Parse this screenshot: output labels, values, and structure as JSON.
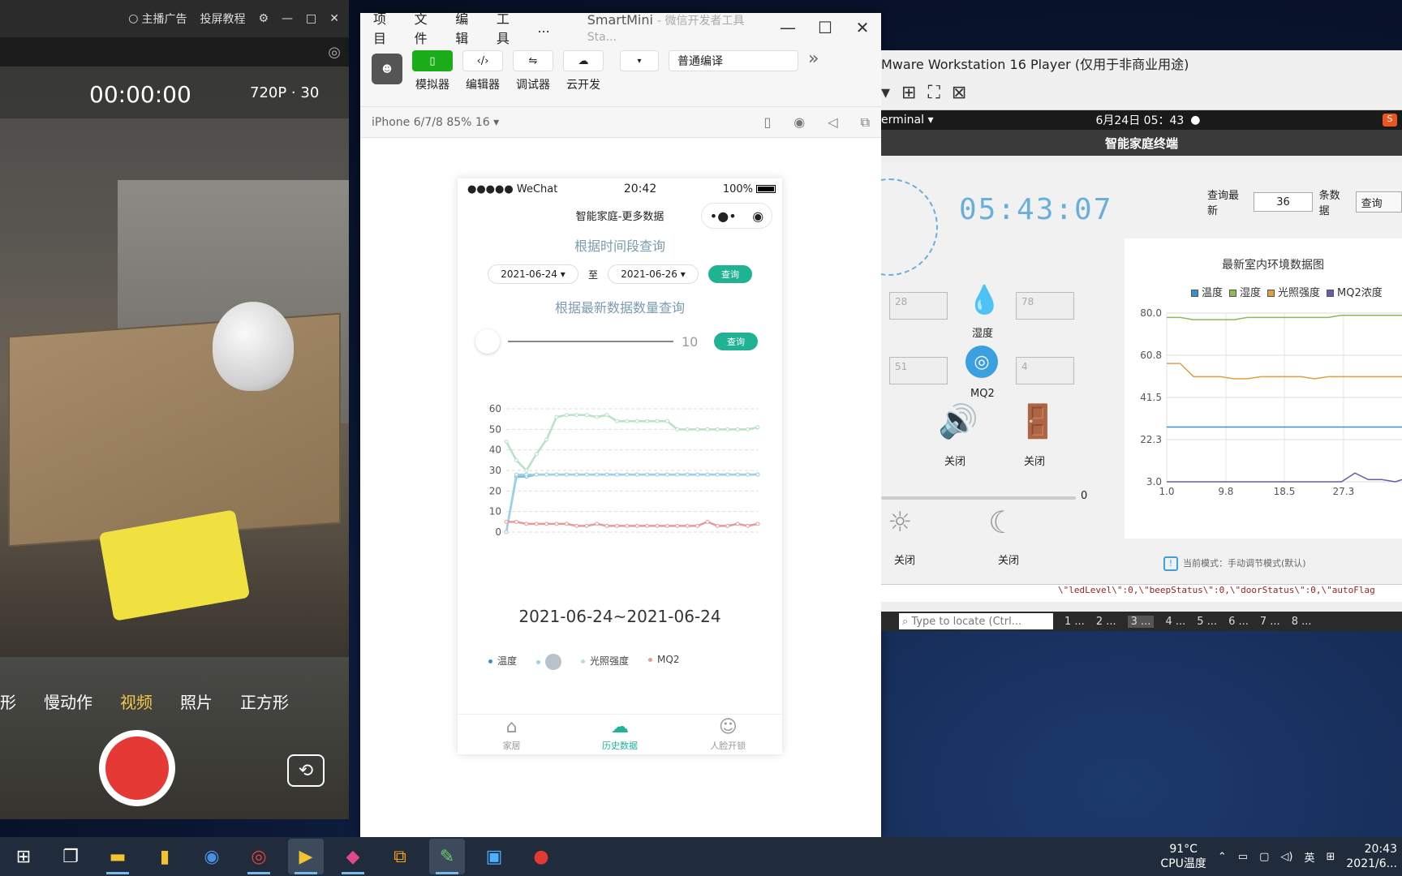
{
  "camera": {
    "title_ad": "主播广告",
    "title_tutorial": "投屏教程",
    "timer": "00:00:00",
    "resolution": "720P · 30",
    "modes": [
      "形",
      "慢动作",
      "视频",
      "照片",
      "正方形"
    ],
    "active_mode": "视频"
  },
  "devtools": {
    "menus": [
      "项目",
      "文件",
      "编辑",
      "工具",
      "..."
    ],
    "title": "SmartMini",
    "subtitle": "- 微信开发者工具 Sta...",
    "tools": [
      {
        "label": "模拟器",
        "icon": "phone-icon"
      },
      {
        "label": "编辑器",
        "icon": "code-icon"
      },
      {
        "label": "调试器",
        "icon": "sliders-icon"
      },
      {
        "label": "云开发",
        "icon": "cloud-icon"
      }
    ],
    "compile_mode": "普通编译",
    "device": "iPhone 6/7/8 85% 16 ▾"
  },
  "phone": {
    "carrier": "●●●●● WeChat",
    "time": "20:42",
    "battery": "100%",
    "nav_title": "智能家庭-更多数据",
    "section1_title": "根据时间段查询",
    "date_from": "2021-06-24",
    "date_to_sep": "至",
    "date_to": "2021-06-26",
    "query_label": "查询",
    "section2_title": "根据最新数据数量查询",
    "slider_value": "10",
    "range_text": "2021-06-24~2021-06-24",
    "tabs": [
      {
        "label": "家居",
        "icon": "home-icon"
      },
      {
        "label": "历史数据",
        "icon": "cloud-download-icon"
      },
      {
        "label": "人脸开锁",
        "icon": "face-icon"
      }
    ]
  },
  "chart_data": [
    {
      "type": "line",
      "ylim": [
        0,
        60
      ],
      "yticks": [
        0,
        10,
        20,
        30,
        40,
        50,
        60
      ],
      "x": [
        0,
        1,
        2,
        3,
        4,
        5,
        6,
        7,
        8,
        9,
        10,
        11,
        12,
        13,
        14,
        15,
        16,
        17,
        18,
        19,
        20,
        21,
        22,
        23,
        24,
        25
      ],
      "series": [
        {
          "name": "温度",
          "color": "#7ab7df",
          "values": [
            0,
            27,
            27,
            28,
            28,
            28,
            28,
            28,
            28,
            28,
            28,
            28,
            28,
            28,
            28,
            28,
            28,
            28,
            28,
            28,
            28,
            28,
            28,
            28,
            28,
            28
          ]
        },
        {
          "name": "",
          "color": "#9ed1e8",
          "values": [
            0,
            28,
            28,
            28,
            28,
            28,
            28,
            28,
            28,
            28,
            28,
            28,
            28,
            28,
            28,
            28,
            28,
            28,
            28,
            28,
            28,
            28,
            28,
            28,
            28,
            28
          ]
        },
        {
          "name": "光照强度",
          "color": "#b6e2c6",
          "values": [
            44,
            35,
            30,
            38,
            45,
            56,
            57,
            57,
            57,
            56,
            57,
            54,
            54,
            54,
            54,
            54,
            54,
            50,
            50,
            50,
            50,
            50,
            50,
            50,
            50,
            51
          ]
        },
        {
          "name": "MQ2",
          "color": "#e89a9a",
          "values": [
            5,
            5,
            4,
            4,
            4,
            4,
            4,
            3,
            3,
            4,
            3,
            3,
            3,
            3,
            3,
            3,
            3,
            3,
            3,
            3,
            5,
            3,
            3,
            4,
            3,
            4
          ]
        }
      ]
    },
    {
      "type": "line",
      "title": "最新室内环境数据图",
      "yticks": [
        3.0,
        22.3,
        41.5,
        60.8,
        80.0
      ],
      "ylim": [
        3.0,
        80.0
      ],
      "xticks": [
        1.0,
        9.8,
        18.5,
        27.3
      ],
      "x": [
        1,
        3,
        5,
        7,
        9,
        11,
        13,
        15,
        17,
        19,
        21,
        23,
        25,
        27,
        29,
        31,
        33,
        35,
        36
      ],
      "series": [
        {
          "name": "温度",
          "color": "#3a8fd0",
          "values": [
            28,
            28,
            28,
            28,
            28,
            28,
            28,
            28,
            28,
            28,
            28,
            28,
            28,
            28,
            28,
            28,
            28,
            28,
            28
          ]
        },
        {
          "name": "湿度",
          "color": "#8fb85a",
          "values": [
            78,
            78,
            77,
            77,
            77,
            77,
            78,
            78,
            78,
            78,
            78,
            78,
            78,
            79,
            79,
            79,
            79,
            79,
            79
          ]
        },
        {
          "name": "光照强度",
          "color": "#e0a040",
          "values": [
            57,
            57,
            51,
            51,
            51,
            50,
            50,
            51,
            51,
            51,
            51,
            50,
            51,
            51,
            51,
            51,
            51,
            51,
            51
          ]
        },
        {
          "name": "MQ2浓度",
          "color": "#6a5aa8",
          "values": [
            3,
            3,
            3,
            3,
            3,
            3,
            3,
            3,
            3,
            3,
            3,
            3,
            3,
            3,
            7,
            4,
            4,
            3,
            4
          ]
        }
      ]
    }
  ],
  "vmware": {
    "title": "Mware Workstation 16 Player (仅用于非商业用途)",
    "terminal_menu": "erminal ▾",
    "datetime": "6月24日  05：43",
    "app_title": "智能家庭终端",
    "digital_clock": "05:43:07",
    "sensors": {
      "temp_value": "28",
      "humidity_value": "78",
      "light_value": "51",
      "mq2_value": "4",
      "humidity_label": "湿度",
      "mq2_label": "MQ2"
    },
    "off1": "关闭",
    "off2": "关闭",
    "off3": "关闭",
    "off4": "关闭",
    "slider_value": "0",
    "query_label": "查询最新",
    "query_count": "36",
    "query_unit": "条数据",
    "query_button": "查询",
    "mode_hint": "当前模式：手动调节模式(默认)",
    "code_line": "\\\"ledLevel\\\":0,\\\"beepStatus\\\":0,\\\"doorStatus\\\":0,\\\"autoFlag",
    "locate_placeholder": "Type to locate (Ctrl...",
    "tabs": [
      "1 ...",
      "2 ...",
      "3 ...",
      "4 ...",
      "5 ...",
      "6 ...",
      "7 ...",
      "8 ..."
    ]
  },
  "taskbar": {
    "cpu_temp": "91°C",
    "cpu_label": "CPU温度",
    "ime": "英",
    "time": "20:43",
    "date": "2021/6..."
  }
}
